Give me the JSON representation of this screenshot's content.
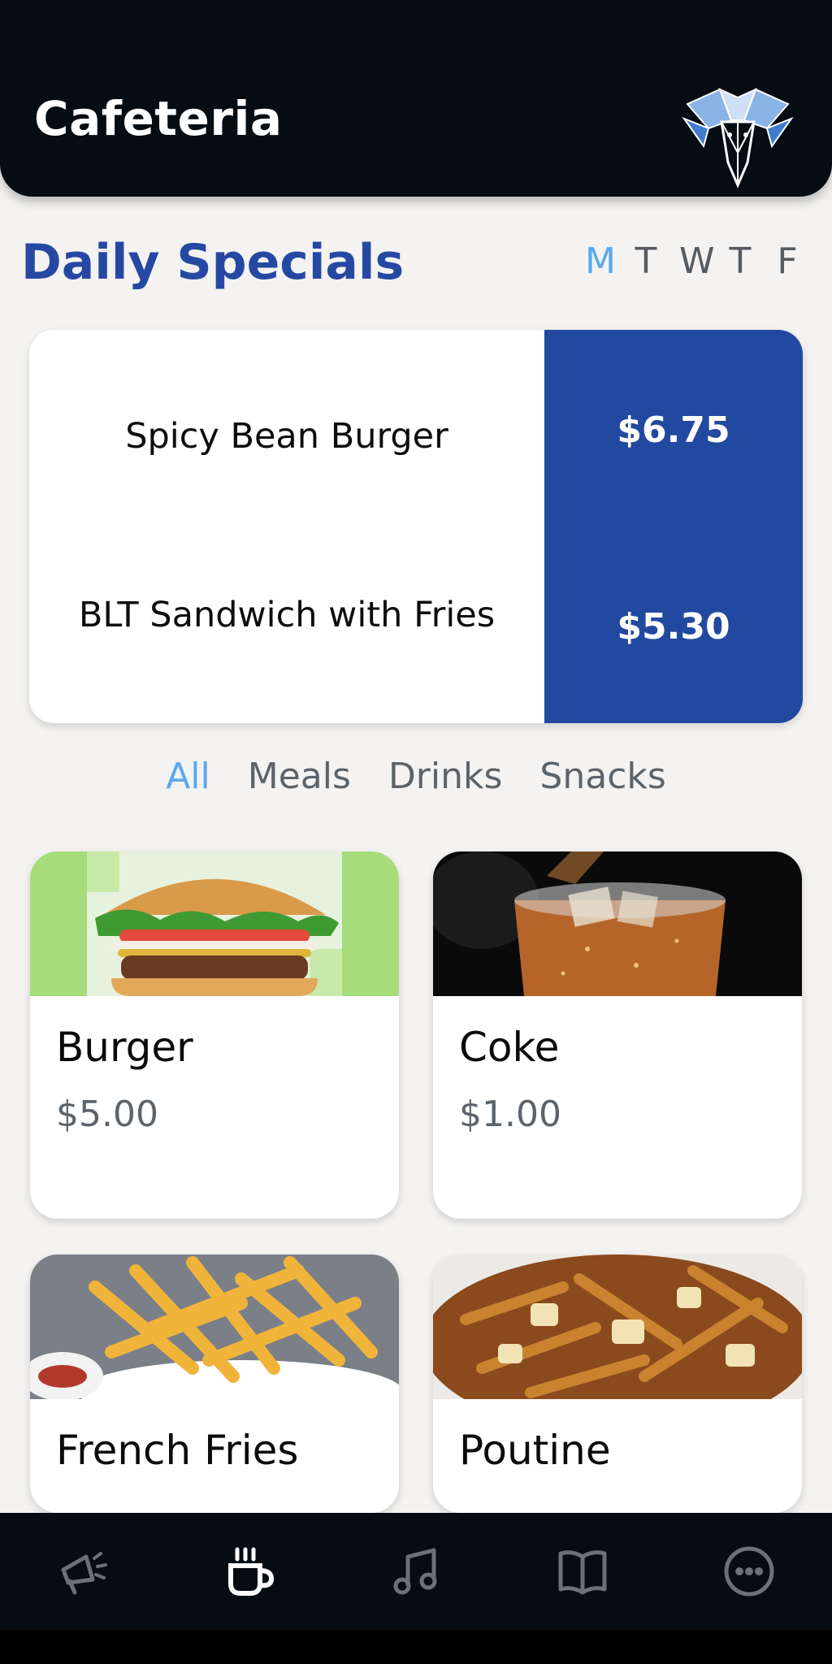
{
  "header": {
    "title": "Cafeteria"
  },
  "specials": {
    "title": "Daily Specials",
    "days": [
      {
        "label": "M",
        "active": true
      },
      {
        "label": "T",
        "active": false
      },
      {
        "label": "W",
        "active": false
      },
      {
        "label": "T",
        "active": false
      },
      {
        "label": "F",
        "active": false
      }
    ],
    "items": [
      {
        "name": "Spicy Bean Burger",
        "price": "$6.75"
      },
      {
        "name": "BLT Sandwich with Fries",
        "price": "$5.30"
      }
    ]
  },
  "filters": [
    {
      "label": "All",
      "active": true
    },
    {
      "label": "Meals",
      "active": false
    },
    {
      "label": "Drinks",
      "active": false
    },
    {
      "label": "Snacks",
      "active": false
    }
  ],
  "menu": [
    {
      "name": "Burger",
      "price": "$5.00"
    },
    {
      "name": "Coke",
      "price": "$1.00"
    },
    {
      "name": "French Fries",
      "price": ""
    },
    {
      "name": "Poutine",
      "price": ""
    }
  ],
  "nav": [
    {
      "icon": "megaphone-icon",
      "active": false
    },
    {
      "icon": "coffee-cup-icon",
      "active": true
    },
    {
      "icon": "music-note-icon",
      "active": false
    },
    {
      "icon": "book-icon",
      "active": false
    },
    {
      "icon": "more-icon",
      "active": false
    }
  ],
  "colors": {
    "accent": "#2249a0",
    "active_tab": "#5aa8ee",
    "header_bg": "#050c12",
    "page_bg": "#f4f3f1"
  }
}
